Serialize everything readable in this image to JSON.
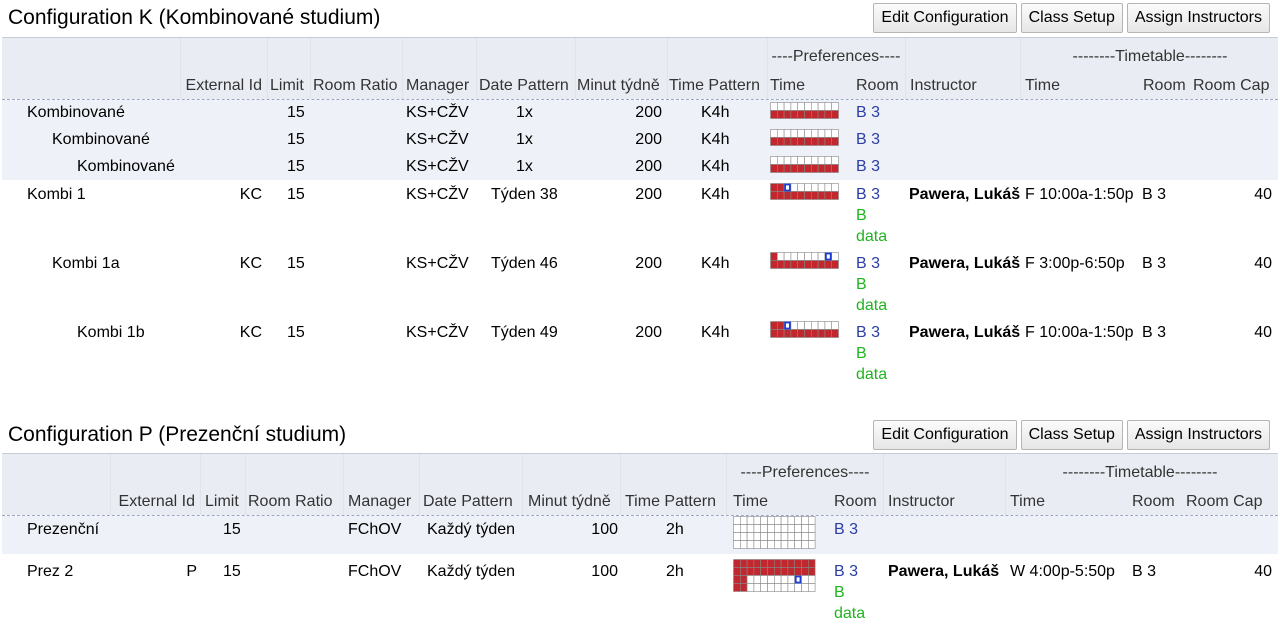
{
  "headers": {
    "preferences": "----Preferences----",
    "timetable": "--------Timetable--------",
    "external_id": "External Id",
    "limit": "Limit",
    "room_ratio": "Room Ratio",
    "manager": "Manager",
    "date_pattern": "Date Pattern",
    "minut_tydne": "Minut týdně",
    "time_pattern": "Time Pattern",
    "time": "Time",
    "room": "Room",
    "instructor": "Instructor",
    "tt_time": "Time",
    "tt_room": "Room",
    "room_cap": "Room Cap"
  },
  "buttons": {
    "edit": "Edit Configuration",
    "class_setup": "Class Setup",
    "assign": "Assign Instructors"
  },
  "configs": [
    {
      "title": "Configuration K (Kombinované studium)",
      "rows": [
        {
          "name": "Kombinované",
          "external_id": "",
          "limit": "15",
          "room_ratio": "",
          "manager": "KS+CŽV",
          "date_pattern": "1x",
          "minutes": "200",
          "time_pattern": "K4h",
          "pref_room": "B 3",
          "pref_extra1": "",
          "pref_extra2": "",
          "instructor": "",
          "tt_time": "",
          "tt_room": "",
          "room_cap": ""
        },
        {
          "name": "Kombinované",
          "external_id": "",
          "limit": "15",
          "room_ratio": "",
          "manager": "KS+CŽV",
          "date_pattern": "1x",
          "minutes": "200",
          "time_pattern": "K4h",
          "pref_room": "B 3",
          "pref_extra1": "",
          "pref_extra2": "",
          "instructor": "",
          "tt_time": "",
          "tt_room": "",
          "room_cap": ""
        },
        {
          "name": "Kombinované",
          "external_id": "",
          "limit": "15",
          "room_ratio": "",
          "manager": "KS+CŽV",
          "date_pattern": "1x",
          "minutes": "200",
          "time_pattern": "K4h",
          "pref_room": "B 3",
          "pref_extra1": "",
          "pref_extra2": "",
          "instructor": "",
          "tt_time": "",
          "tt_room": "",
          "room_cap": ""
        },
        {
          "name": "Kombi 1",
          "external_id": "KC",
          "limit": "15",
          "room_ratio": "",
          "manager": "KS+CŽV",
          "date_pattern": "Týden 38",
          "minutes": "200",
          "time_pattern": "K4h",
          "pref_room": "B 3",
          "pref_extra1": "B",
          "pref_extra2": "data",
          "instructor": "Pawera, Lukáš",
          "tt_time": "F 10:00a-1:50p",
          "tt_room": "B 3",
          "room_cap": "40"
        },
        {
          "name": "Kombi 1a",
          "external_id": "KC",
          "limit": "15",
          "room_ratio": "",
          "manager": "KS+CŽV",
          "date_pattern": "Týden 46",
          "minutes": "200",
          "time_pattern": "K4h",
          "pref_room": "B 3",
          "pref_extra1": "B",
          "pref_extra2": "data",
          "instructor": "Pawera, Lukáš",
          "tt_time": "F 3:00p-6:50p",
          "tt_room": "B 3",
          "room_cap": "40"
        },
        {
          "name": "Kombi 1b",
          "external_id": "KC",
          "limit": "15",
          "room_ratio": "",
          "manager": "KS+CŽV",
          "date_pattern": "Týden 49",
          "minutes": "200",
          "time_pattern": "K4h",
          "pref_room": "B 3",
          "pref_extra1": "B",
          "pref_extra2": "data",
          "instructor": "Pawera, Lukáš",
          "tt_time": "F 10:00a-1:50p",
          "tt_room": "B 3",
          "room_cap": "40"
        }
      ]
    },
    {
      "title": "Configuration P (Prezenční studium)",
      "rows": [
        {
          "name": "Prezenční",
          "external_id": "",
          "limit": "15",
          "room_ratio": "",
          "manager": "FChOV",
          "date_pattern": "Každý týden",
          "minutes": "100",
          "time_pattern": "2h",
          "pref_room": "B 3",
          "pref_extra1": "",
          "pref_extra2": "",
          "instructor": "",
          "tt_time": "",
          "tt_room": "",
          "room_cap": ""
        },
        {
          "name": "Prez 2",
          "external_id": "P",
          "limit": "15",
          "room_ratio": "",
          "manager": "FChOV",
          "date_pattern": "Každý týden",
          "minutes": "100",
          "time_pattern": "2h",
          "pref_room": "B 3",
          "pref_extra1": "B",
          "pref_extra2": "data",
          "instructor": "Pawera, Lukáš",
          "tt_time": "W 4:00p-5:50p",
          "tt_room": "B 3",
          "room_cap": "40"
        }
      ]
    }
  ],
  "colors": {
    "pref_required": "#c1272d",
    "pref_neutral": "#ffffff",
    "pref_grid": "#888888",
    "pref_marker": "#1c3fd6",
    "room_link": "#2b3ea6",
    "room_extra": "#1fb51f",
    "header_bg": "#e9edf3"
  },
  "icons": {
    "time_preference": "time-preference-grid-icon"
  }
}
